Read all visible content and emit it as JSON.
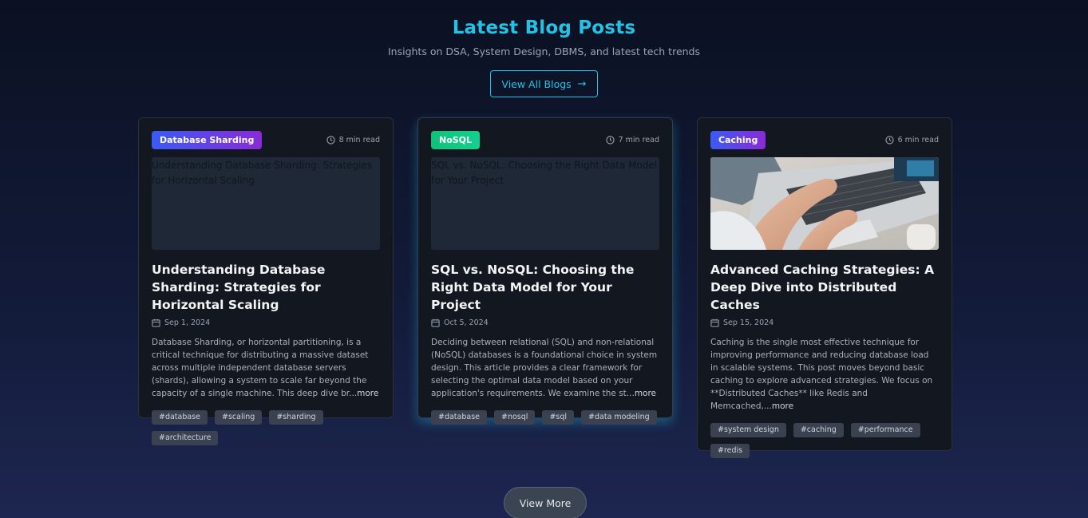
{
  "header": {
    "title": "Latest Blog Posts",
    "subtitle": "Insights on DSA, System Design, DBMS, and latest tech trends",
    "view_all_label": "View All Blogs"
  },
  "posts": [
    {
      "category": "Database Sharding",
      "category_colors": [
        "#3a5bf5",
        "#8a2ad8"
      ],
      "read_time": "8 min read",
      "image_alt": "Understanding Database Sharding: Strategies for Horizontal Scaling",
      "title": "Understanding Database Sharding: Strategies for Horizontal Scaling",
      "date": "Sep 1, 2024",
      "excerpt": "Database Sharding, or horizontal partitioning, is a critical technique for distributing a massive dataset across multiple independent database servers (shards), allowing a system to scale far beyond the capacity of a single machine. This deep dive br...",
      "more": "more",
      "tags": [
        "#database",
        "#scaling",
        "#sharding",
        "#architecture"
      ]
    },
    {
      "category": "NoSQL",
      "category_colors": [
        "#10c27a",
        "#13d18f"
      ],
      "read_time": "7 min read",
      "image_alt": "SQL vs. NoSQL: Choosing the Right Data Model for Your Project",
      "title": "SQL vs. NoSQL: Choosing the Right Data Model for Your Project",
      "date": "Oct 5, 2024",
      "excerpt": "Deciding between relational (SQL) and non-relational (NoSQL) databases is a foundational choice in system design. This article provides a clear framework for selecting the optimal data model based on your application's requirements. We examine the st...",
      "more": "more",
      "tags": [
        "#database",
        "#nosql",
        "#sql",
        "#data modeling"
      ]
    },
    {
      "category": "Caching",
      "category_colors": [
        "#3a5bf5",
        "#8a2ad8"
      ],
      "read_time": "6 min read",
      "title": "Advanced Caching Strategies: A Deep Dive into Distributed Caches",
      "date": "Sep 15, 2024",
      "excerpt": "Caching is the single most effective technique for improving performance and reducing database load in scalable systems. This post moves beyond basic caching to explore advanced strategies. We focus on **Distributed Caches** like Redis and Memcached,...",
      "more": "more",
      "tags": [
        "#system design",
        "#caching",
        "#performance",
        "#redis"
      ]
    }
  ],
  "view_more_label": "View More",
  "colors": {
    "accent": "#22c3e6",
    "card_bg": "#131820",
    "tag_bg": "#3a4150"
  }
}
